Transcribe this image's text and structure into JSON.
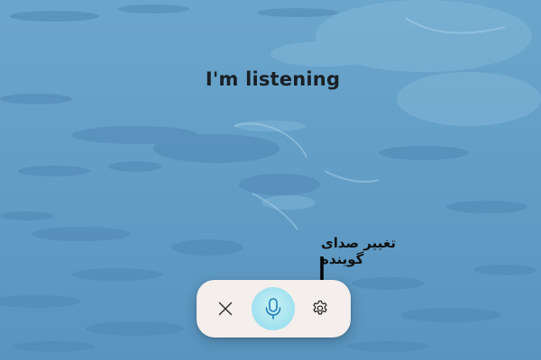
{
  "status": {
    "text": "I'm listening"
  },
  "annotation": {
    "text": "تغییر صدای گوینده"
  },
  "voice_bar": {
    "close_icon": "close-icon",
    "mic_icon": "microphone-icon",
    "settings_icon": "gear-icon",
    "mic_color": "#1f7fb8",
    "background_color": "#f4efec"
  },
  "colors": {
    "wallpaper": "#5c98c3",
    "text": "#1a1f24"
  }
}
